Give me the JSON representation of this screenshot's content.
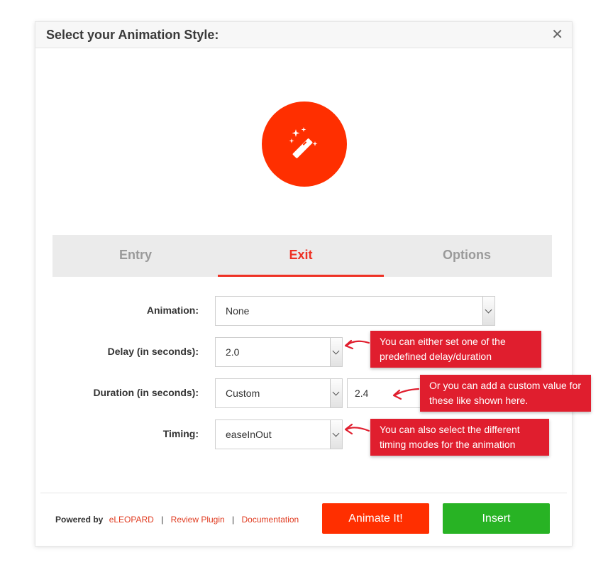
{
  "dialog": {
    "title": "Select your Animation Style:",
    "close_label": "✕"
  },
  "hero": {
    "icon": "magic-wand-icon",
    "color": "#ff2f00"
  },
  "tabs": [
    {
      "label": "Entry",
      "active": false
    },
    {
      "label": "Exit",
      "active": true
    },
    {
      "label": "Options",
      "active": false
    }
  ],
  "form": {
    "animation": {
      "label": "Animation:",
      "value": "None"
    },
    "delay": {
      "label": "Delay (in seconds):",
      "value": "2.0"
    },
    "duration": {
      "label": "Duration (in seconds):",
      "value": "Custom",
      "custom_value": "2.4"
    },
    "timing": {
      "label": "Timing:",
      "value": "easeInOut"
    }
  },
  "tooltips": {
    "delay": "You can either set one of the predefined delay/duration",
    "custom": "Or you can add a custom value for these like shown here.",
    "timing": "You can also select the different timing modes for the animation"
  },
  "footer": {
    "powered_by": "Powered by",
    "brand": "eLEOPARD",
    "review": "Review Plugin",
    "docs": "Documentation",
    "separator": "|",
    "animate_button": "Animate It!",
    "insert_button": "Insert"
  },
  "colors": {
    "accent": "#ff2f00",
    "tooltip": "#e01e2e",
    "insert": "#28b324",
    "tab_active": "#ee3124"
  }
}
